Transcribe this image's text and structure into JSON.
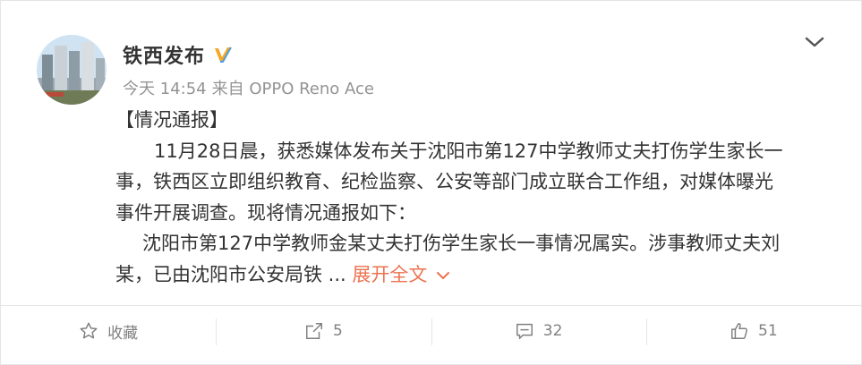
{
  "author": {
    "name": "铁西发布",
    "verified_icon": "verified-v-icon"
  },
  "meta": {
    "time": "今天 14:54",
    "source": "来自 OPPO Reno Ace"
  },
  "post": {
    "tag": "【情况通报】",
    "paragraph1_line1": "11月28日晨，获悉媒体发布关于沈阳市第127中学教师丈夫打伤学生家长一",
    "paragraph1_line2": "事，铁西区立即组织教育、纪检监察、公安等部门成立联合工作组，对媒体曝光",
    "paragraph1_line3": "事件开展调查。现将情况通报如下：",
    "paragraph2_line1": "沈阳市第127中学教师金某丈夫打伤学生家长一事情况属实。涉事教师丈夫刘",
    "paragraph2_line2": "某，已由沈阳市公安局铁 ...",
    "expand_label": "展开全文"
  },
  "actions": {
    "favorite": {
      "label": "收藏",
      "icon": "star-icon"
    },
    "repost": {
      "label": "5",
      "icon": "repost-icon"
    },
    "comment": {
      "label": "32",
      "icon": "comment-icon"
    },
    "like": {
      "label": "51",
      "icon": "thumbs-up-icon"
    }
  },
  "colors": {
    "accent": "#eb7350",
    "verified": "#f6a623",
    "muted": "#939393"
  }
}
